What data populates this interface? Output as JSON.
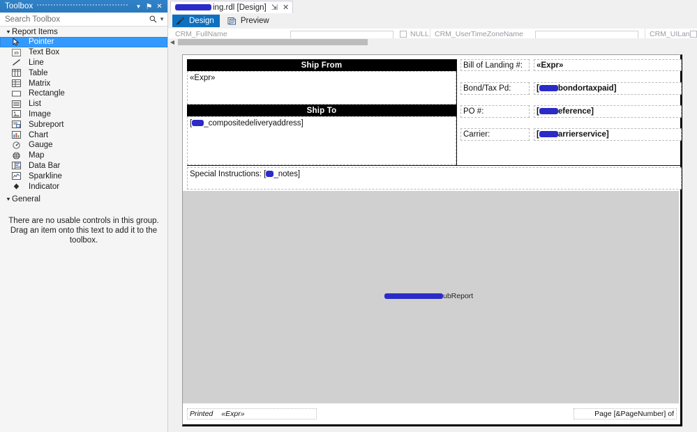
{
  "toolbox": {
    "title": "Toolbox",
    "window_buttons": [
      {
        "name": "dropdown",
        "glyph": "▼"
      },
      {
        "name": "pin",
        "glyph": "⚑"
      },
      {
        "name": "close",
        "glyph": "✕"
      }
    ],
    "search_placeholder": "Search Toolbox",
    "search_value": "",
    "groups": [
      {
        "label": "Report Items",
        "expanded": true,
        "items": [
          {
            "label": "Pointer",
            "icon": "pointer-icon",
            "selected": true
          },
          {
            "label": "Text Box",
            "icon": "textbox-icon",
            "selected": false
          },
          {
            "label": "Line",
            "icon": "line-icon",
            "selected": false
          },
          {
            "label": "Table",
            "icon": "table-icon",
            "selected": false
          },
          {
            "label": "Matrix",
            "icon": "matrix-icon",
            "selected": false
          },
          {
            "label": "Rectangle",
            "icon": "rectangle-icon",
            "selected": false
          },
          {
            "label": "List",
            "icon": "list-icon",
            "selected": false
          },
          {
            "label": "Image",
            "icon": "image-icon",
            "selected": false
          },
          {
            "label": "Subreport",
            "icon": "subreport-icon",
            "selected": false
          },
          {
            "label": "Chart",
            "icon": "chart-icon",
            "selected": false
          },
          {
            "label": "Gauge",
            "icon": "gauge-icon",
            "selected": false
          },
          {
            "label": "Map",
            "icon": "map-icon",
            "selected": false
          },
          {
            "label": "Data Bar",
            "icon": "databar-icon",
            "selected": false
          },
          {
            "label": "Sparkline",
            "icon": "sparkline-icon",
            "selected": false
          },
          {
            "label": "Indicator",
            "icon": "indicator-icon",
            "selected": false
          }
        ]
      },
      {
        "label": "General",
        "expanded": true,
        "items": [],
        "empty_text": "There are no usable controls in this group. Drag an item onto this text to add it to the toolbox."
      }
    ]
  },
  "document": {
    "tab": {
      "redacted_prefix": true,
      "label": "ing.rdl [Design]",
      "pin_glyph": "⇲",
      "close_glyph": "✕"
    },
    "view_tabs": [
      {
        "label": "Design",
        "icon": "design-icon",
        "active": true
      },
      {
        "label": "Preview",
        "icon": "preview-icon",
        "active": false
      }
    ]
  },
  "parameters_bar": {
    "fields": [
      {
        "label": "CRM_FullName",
        "value": ""
      },
      {
        "label": "NULL",
        "value": ""
      },
      {
        "label": "CRM_UserTimeZoneName",
        "value": ""
      },
      {
        "label": "CRM_UILanguageId",
        "value": ""
      }
    ]
  },
  "scrollbar": {
    "left_arrow": "◀",
    "thumb_label": "horizontal-scroll-thumb"
  },
  "report": {
    "ship_from": {
      "header": "Ship From",
      "value": "«Expr»"
    },
    "ship_to": {
      "header": "Ship To",
      "value_prefix": "[",
      "value_redacted": true,
      "value_suffix": "_compositedeliveryaddress]"
    },
    "fields": [
      {
        "label": "Bill of Landing #:",
        "value": "«Expr»",
        "value_redacted": false,
        "value_bold": true
      },
      {
        "label": "Bond/Tax Pd:",
        "value_prefix": "[",
        "value_redacted": true,
        "value_suffix": "bondortaxpaid]",
        "value_bold": true
      },
      {
        "label": "PO #:",
        "value_prefix": "[",
        "value_redacted": true,
        "value_suffix": "eference]",
        "value_bold": true
      },
      {
        "label": "Carrier:",
        "value_prefix": "[",
        "value_redacted": true,
        "value_suffix": "arrierservice]",
        "value_bold": true
      }
    ],
    "special_instructions": {
      "label": "Special Instructions:",
      "value_prefix": " [",
      "value_redacted": true,
      "value_suffix": "_notes]"
    },
    "subreport": {
      "redacted": true,
      "label": "ubReport"
    },
    "footer": {
      "printed_label": "Printed",
      "printed_value": "«Expr»",
      "page_text": "Page [&PageNumber] of"
    }
  },
  "colors": {
    "accent": "#0e70c0",
    "titlebar": "#2e7fc4",
    "selection": "#3399ff",
    "redaction": "#2b2bc8",
    "page_body": "#d0d0d0",
    "chrome": "#f0f0f0"
  }
}
